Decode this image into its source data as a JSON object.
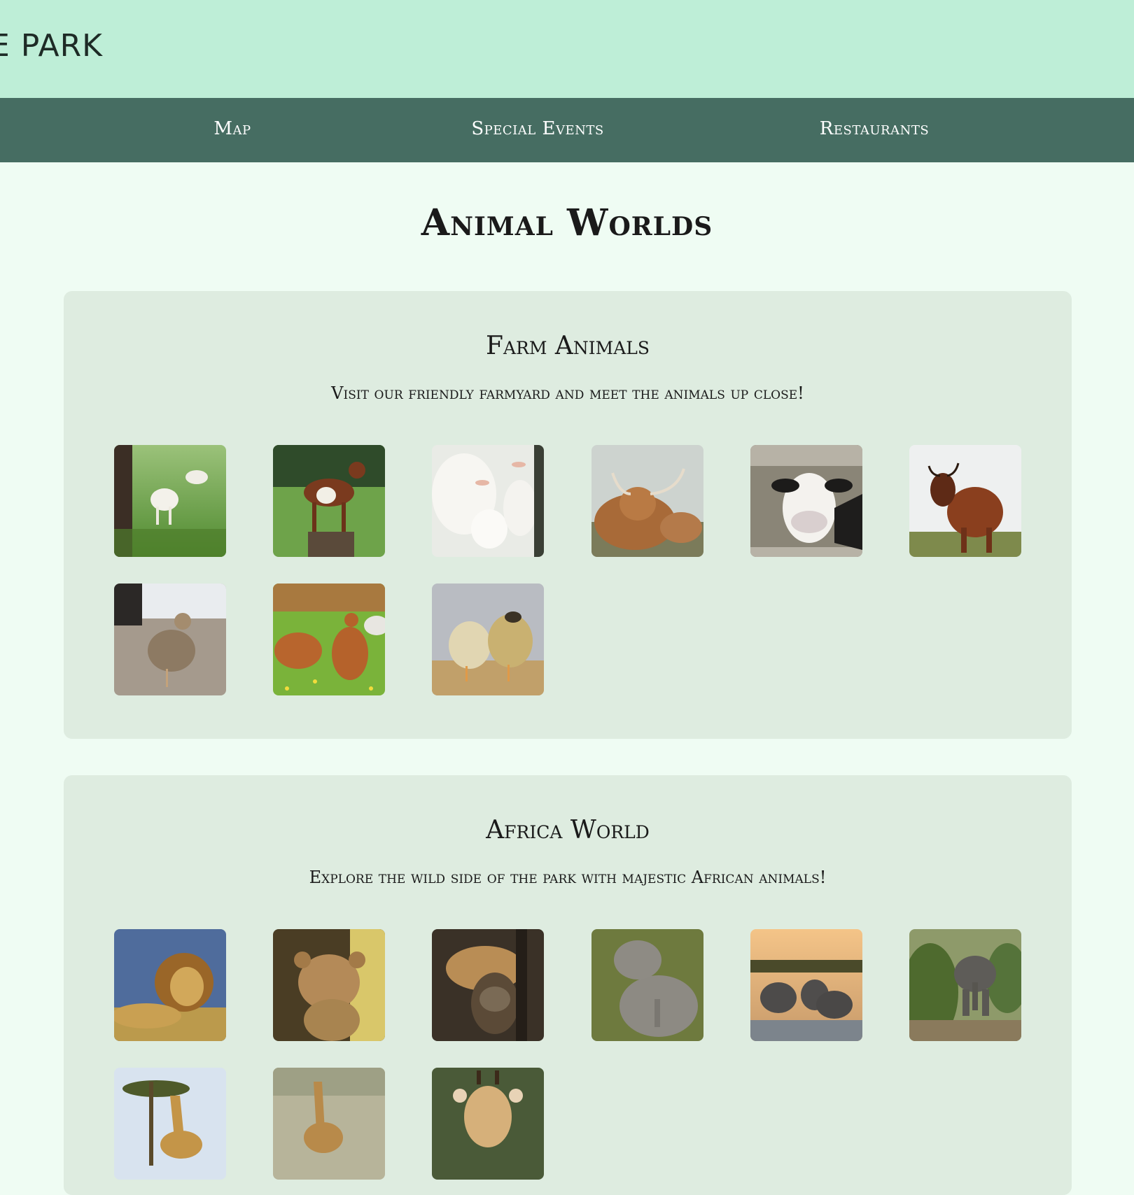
{
  "header": {
    "logo_text": "E PARK"
  },
  "nav": {
    "items": [
      {
        "label": "Map"
      },
      {
        "label": "Special Events"
      },
      {
        "label": "Restaurants"
      }
    ]
  },
  "main": {
    "title": "Animal Worlds",
    "worlds": [
      {
        "title": "Farm Animals",
        "description": "Visit our friendly farmyard and meet the animals up close!",
        "photos": [
          {
            "subject": "white goat in grass"
          },
          {
            "subject": "brown goat on stump"
          },
          {
            "subject": "white goat kids"
          },
          {
            "subject": "highland cow"
          },
          {
            "subject": "cow behind fence"
          },
          {
            "subject": "brown cow with horns"
          },
          {
            "subject": "hen on gravel"
          },
          {
            "subject": "hens in flowers"
          },
          {
            "subject": "two chicks"
          }
        ]
      },
      {
        "title": "Africa World",
        "description": "Explore the wild side of the park with majestic African animals!",
        "photos": [
          {
            "subject": "lion lying in grass"
          },
          {
            "subject": "lion cub"
          },
          {
            "subject": "lioness in tree"
          },
          {
            "subject": "baby elephants"
          },
          {
            "subject": "elephants at sunset"
          },
          {
            "subject": "elephant in bush"
          },
          {
            "subject": "giraffe under tree"
          },
          {
            "subject": "young giraffe"
          },
          {
            "subject": "giraffe head"
          }
        ]
      }
    ]
  }
}
